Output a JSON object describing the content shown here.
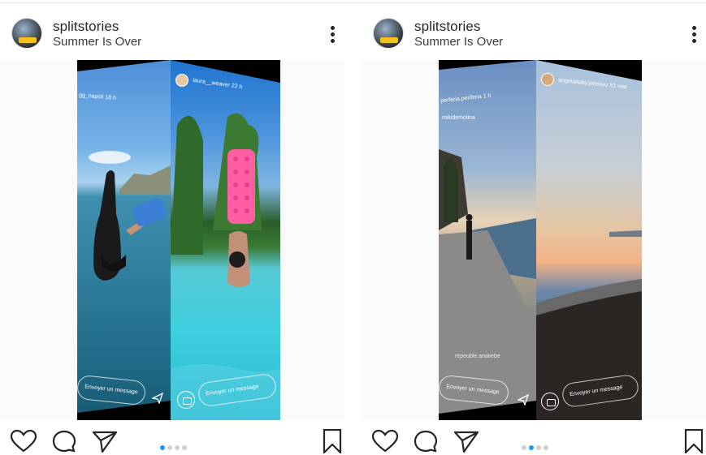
{
  "posts": [
    {
      "username": "splitstories",
      "subtitle": "Summer Is Over",
      "story": {
        "left_caption": "gg_napoli 18 h",
        "right_caption": "laura__weaver 22 h",
        "left_message_placeholder": "Envoyer un message",
        "right_message_placeholder": "Envoyer un message"
      },
      "carousel": {
        "count": 4,
        "active_index": 0
      }
    },
    {
      "username": "splitstories",
      "subtitle": "Summer Is Over",
      "story": {
        "left_caption": "perferia.periferia 1 h",
        "left_caption_2": "mikidemolina",
        "left_caption_3": "repeuble.analiebe",
        "right_caption": "angelababy.jimenez 51 min",
        "left_message_placeholder": "Envoyer un message",
        "right_message_placeholder": "Envoyer un message"
      },
      "carousel": {
        "count": 4,
        "active_index": 1
      }
    }
  ],
  "icons": {
    "more": "more-vertical-icon",
    "like": "heart-icon",
    "comment": "comment-icon",
    "share": "send-icon",
    "save": "bookmark-icon",
    "camera": "camera-icon"
  },
  "colors": {
    "active_dot": "#2196f3",
    "inactive_dot": "#cfcfcf",
    "text": "#262626"
  }
}
